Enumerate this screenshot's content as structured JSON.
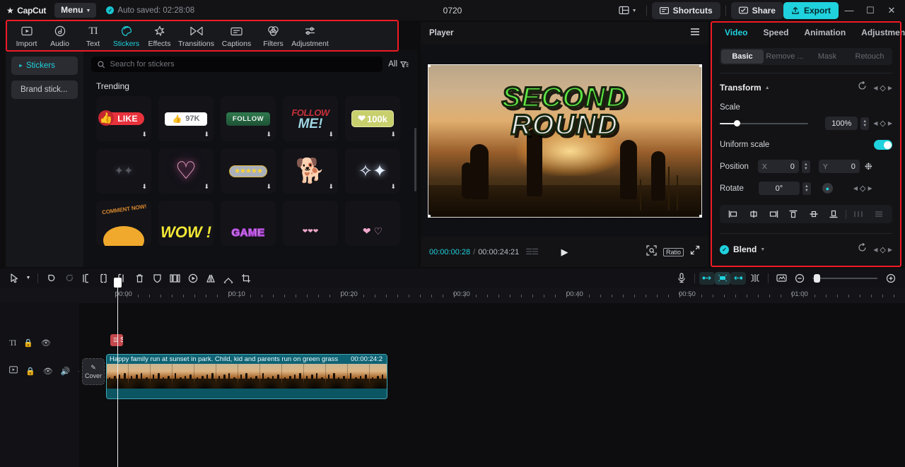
{
  "titlebar": {
    "app_name": "CapCut",
    "menu_label": "Menu",
    "autosave": "Auto saved: 02:28:08",
    "project_title": "0720",
    "shortcuts_label": "Shortcuts",
    "share_label": "Share",
    "export_label": "Export",
    "layout_icon": "layout-icon",
    "minimize_icon": "minimize-icon",
    "maximize_icon": "maximize-icon",
    "close_icon": "close-icon"
  },
  "tooltabs": [
    {
      "label": "Import",
      "icon": "import-icon",
      "active": false
    },
    {
      "label": "Audio",
      "icon": "audio-icon",
      "active": false
    },
    {
      "label": "Text",
      "icon": "text-icon",
      "active": false
    },
    {
      "label": "Stickers",
      "icon": "stickers-icon",
      "active": true
    },
    {
      "label": "Effects",
      "icon": "effects-icon",
      "active": false
    },
    {
      "label": "Transitions",
      "icon": "transitions-icon",
      "active": false
    },
    {
      "label": "Captions",
      "icon": "captions-icon",
      "active": false
    },
    {
      "label": "Filters",
      "icon": "filters-icon",
      "active": false
    },
    {
      "label": "Adjustment",
      "icon": "adjustment-icon",
      "active": false
    }
  ],
  "left_panel": {
    "categories": [
      {
        "label": "Stickers",
        "active": true
      },
      {
        "label": "Brand stick...",
        "active": false
      }
    ],
    "search_placeholder": "Search for stickers",
    "search_value": "",
    "filter_label": "All",
    "section_title": "Trending",
    "stickers": [
      {
        "name": "like-sticker",
        "text": "LIKE"
      },
      {
        "name": "97k-sticker",
        "text": "97K"
      },
      {
        "name": "follow-sticker",
        "text": "FOLLOW"
      },
      {
        "name": "follow-me-sticker",
        "text": "FOLLOW ME!"
      },
      {
        "name": "100k-sticker",
        "text": "100k"
      },
      {
        "name": "dark-sparkle-sticker",
        "text": ""
      },
      {
        "name": "neon-heart-sticker",
        "text": ""
      },
      {
        "name": "five-star-sticker",
        "text": "★★★★★"
      },
      {
        "name": "dog-sticker",
        "text": ""
      },
      {
        "name": "glitter-sticker",
        "text": ""
      },
      {
        "name": "comment-now-sticker",
        "text": "COMMENT NOW!"
      },
      {
        "name": "wow-sticker",
        "text": "WOW !"
      },
      {
        "name": "game-sticker",
        "text": "GAME"
      },
      {
        "name": "small-hearts-sticker",
        "text": ""
      },
      {
        "name": "pink-hearts-sticker",
        "text": ""
      }
    ]
  },
  "player": {
    "title": "Player",
    "menu_icon": "hamburger-icon",
    "overlay_line1": "SECOND",
    "overlay_line2": "ROUND",
    "current_time": "00:00:00:28",
    "time_separator": "/",
    "total_time": "00:00:24:21",
    "play_icon": "play-icon",
    "zoom_icon": "zoom-fit-icon",
    "ratio_label": "Ratio",
    "fullscreen_icon": "fullscreen-icon"
  },
  "right_panel": {
    "tabs": [
      {
        "label": "Video",
        "active": true
      },
      {
        "label": "Speed",
        "active": false
      },
      {
        "label": "Animation",
        "active": false
      },
      {
        "label": "Adjustment",
        "active": false
      }
    ],
    "subtabs": [
      {
        "label": "Basic",
        "active": true
      },
      {
        "label": "Remove ...",
        "active": false
      },
      {
        "label": "Mask",
        "active": false
      },
      {
        "label": "Retouch",
        "active": false
      }
    ],
    "transform": {
      "title": "Transform",
      "reset_icon": "reset-icon",
      "keyframe_icon": "keyframe-icon",
      "scale_label": "Scale",
      "scale_value": "100%",
      "uniform_scale_label": "Uniform scale",
      "uniform_scale_on": true,
      "position_label": "Position",
      "position_x_axis": "X",
      "position_x": "0",
      "position_y_axis": "Y",
      "position_y": "0",
      "rotate_label": "Rotate",
      "rotate_value": "0°"
    },
    "align_buttons": [
      "align-left-icon",
      "align-center-horizontal-icon",
      "align-right-icon",
      "align-top-icon",
      "align-middle-vertical-icon",
      "align-bottom-icon",
      "distribute-horizontal-icon",
      "distribute-vertical-icon"
    ],
    "blend": {
      "label": "Blend",
      "checked": true,
      "reset_icon": "reset-icon",
      "keyframe_icon": "keyframe-icon"
    },
    "accent_color": "#1fd2dd",
    "highlight_border": "#ef1b25"
  },
  "timeline": {
    "toolbar_left": [
      "select-tool-icon",
      "select-dropdown-caret",
      "undo-icon",
      "redo-icon",
      "split-icon",
      "trim-left-icon",
      "trim-right-icon",
      "delete-icon",
      "shield-icon",
      "freeze-frame-icon",
      "reverse-icon",
      "mirror-icon",
      "rotate-icon",
      "crop-icon"
    ],
    "toolbar_right": [
      "microphone-icon",
      "auto-cut-icon",
      "auto-cut-active-icon",
      "auto-cut-alt-icon",
      "split-marker-icon",
      "preview-icon",
      "zoom-out-icon",
      "zoom-slider",
      "zoom-in-icon"
    ],
    "ruler_labels": [
      "00:00",
      "00:10",
      "00:20",
      "00:30",
      "00:40",
      "00:50",
      "01:00"
    ],
    "tracks": [
      {
        "name": "text-track",
        "controls": [
          "text-track-icon",
          "lock-icon",
          "eye-icon"
        ],
        "clip_label": "S"
      },
      {
        "name": "video-track",
        "controls": [
          "video-track-icon",
          "lock-icon",
          "eye-icon",
          "mute-icon",
          "more-icon"
        ],
        "cover_label": "Cover",
        "clip_title": "Happy family run at sunset in park. Child, kid and parents run on green grass",
        "clip_duration": "00:00:24:2"
      }
    ]
  }
}
